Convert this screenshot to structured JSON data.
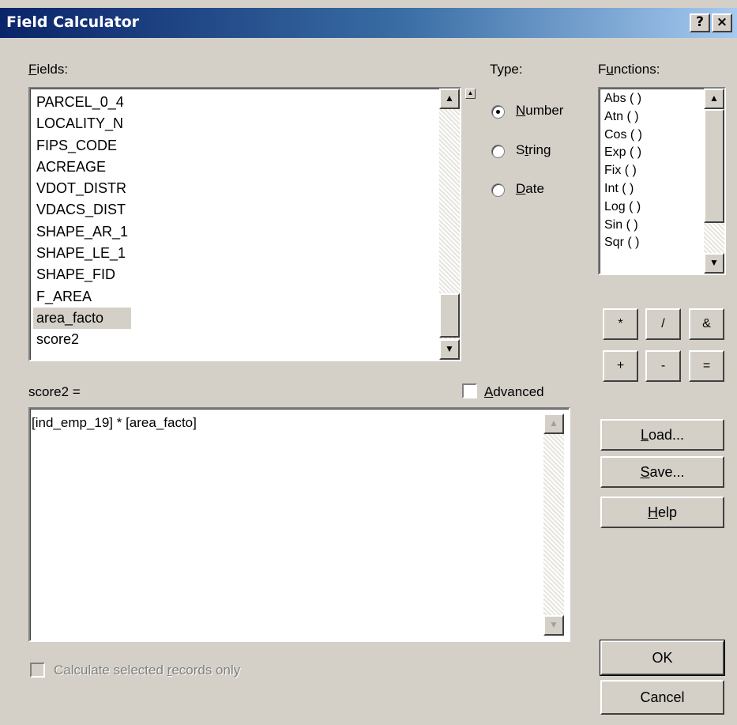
{
  "window": {
    "title": "Field Calculator",
    "help_button": "?",
    "close_button": "×"
  },
  "fields": {
    "label": "Fields:",
    "items": [
      "PARCEL_0_4",
      "LOCALITY_N",
      "FIPS_CODE",
      "ACREAGE",
      "VDOT_DISTR",
      "VDACS_DIST",
      "SHAPE_AR_1",
      "SHAPE_LE_1",
      "SHAPE_FID",
      "F_AREA",
      "area_facto",
      "score2"
    ],
    "selected": "area_facto"
  },
  "type": {
    "label": "Type:",
    "options": [
      "Number",
      "String",
      "Date"
    ],
    "selected": "Number"
  },
  "functions": {
    "label": "Functions:",
    "items": [
      "Abs ( )",
      "Atn ( )",
      "Cos ( )",
      "Exp ( )",
      "Fix ( )",
      "Int ( )",
      "Log ( )",
      "Sin ( )",
      "Sqr ( )"
    ]
  },
  "operators": [
    "*",
    "/",
    "&",
    "+",
    "-",
    "="
  ],
  "expression": {
    "label": "score2 =",
    "value": "[ind_emp_19] * [area_facto]",
    "advanced_label": "Advanced",
    "advanced_checked": false
  },
  "buttons": {
    "load": "Load...",
    "save": "Save...",
    "help": "Help",
    "ok": "OK",
    "cancel": "Cancel"
  },
  "calculate_selected": {
    "label": "Calculate selected records only",
    "checked": false,
    "enabled": false
  }
}
